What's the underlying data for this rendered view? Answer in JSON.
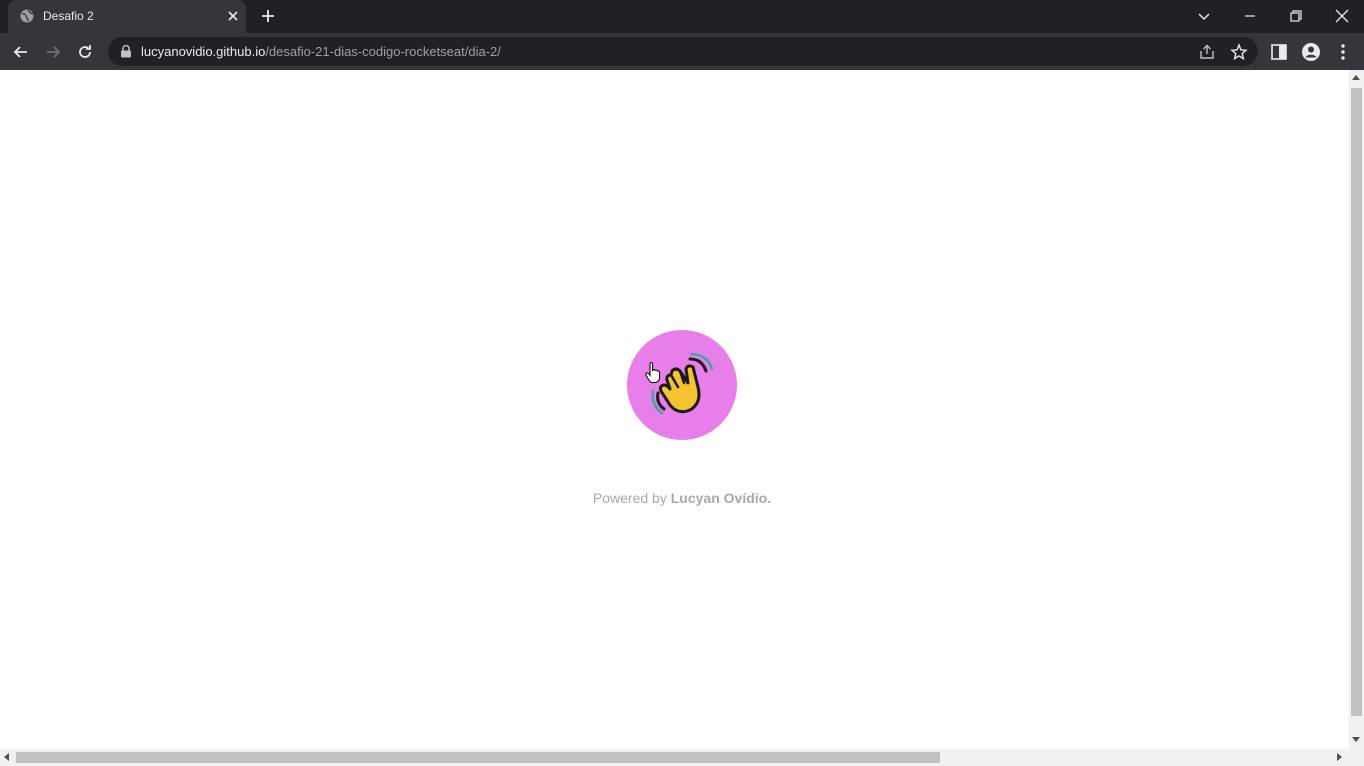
{
  "browser": {
    "tab_title": "Desafio 2",
    "url_host": "lucyanovidio.github.io",
    "url_path": "/desafio-21-dias-codigo-rocketseat/dia-2/"
  },
  "page": {
    "avatar_icon": "waving-hand-icon",
    "avatar_color": "#e87ee9",
    "credit_prefix": "Powered by",
    "credit_name": "Lucyan Ovídio."
  }
}
